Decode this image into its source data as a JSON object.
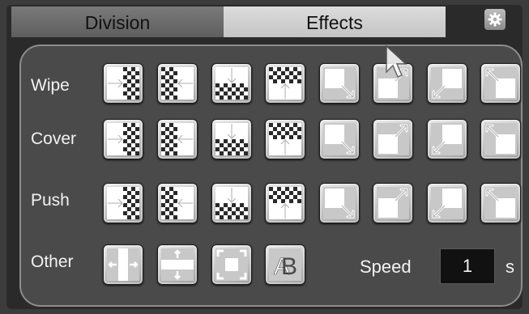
{
  "tabs": {
    "division": "Division",
    "effects": "Effects"
  },
  "settings_icon": "gear-icon",
  "rows": [
    {
      "label": "Wipe",
      "effects": [
        "wipe-left",
        "wipe-right",
        "wipe-down",
        "wipe-up",
        "wipe-bottom-right",
        "wipe-top-right",
        "wipe-bottom-left",
        "wipe-top-left"
      ]
    },
    {
      "label": "Cover",
      "effects": [
        "cover-left",
        "cover-right",
        "cover-down",
        "cover-up",
        "cover-bottom-right",
        "cover-top-right",
        "cover-bottom-left",
        "cover-top-left"
      ]
    },
    {
      "label": "Push",
      "effects": [
        "push-left",
        "push-right",
        "push-down",
        "push-up",
        "push-bottom-right",
        "push-top-right",
        "push-bottom-left",
        "push-top-left"
      ]
    },
    {
      "label": "Other",
      "effects": [
        "split-horizontal",
        "split-vertical",
        "zoom-center",
        "crossfade-ab"
      ]
    }
  ],
  "crossfade_text": "AB",
  "speed": {
    "label": "Speed",
    "value": "1",
    "unit": "s"
  },
  "colors": {
    "panel": "#4a4a4a",
    "active_tab": "#d0d0d0",
    "inactive_tab": "#6a6a6a"
  }
}
